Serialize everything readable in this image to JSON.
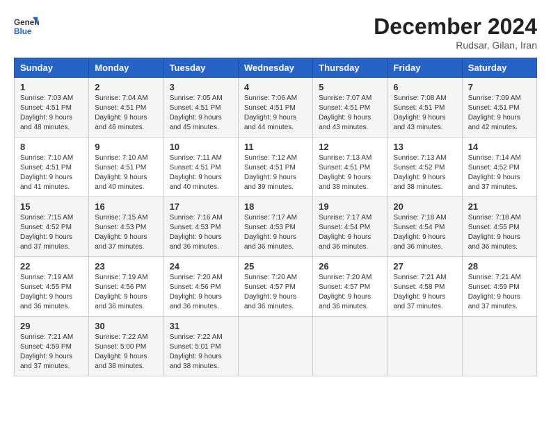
{
  "header": {
    "logo_general": "General",
    "logo_blue": "Blue",
    "title": "December 2024",
    "subtitle": "Rudsar, Gilan, Iran"
  },
  "days_of_week": [
    "Sunday",
    "Monday",
    "Tuesday",
    "Wednesday",
    "Thursday",
    "Friday",
    "Saturday"
  ],
  "weeks": [
    [
      {
        "day": "1",
        "sunrise": "7:03 AM",
        "sunset": "4:51 PM",
        "daylight": "9 hours and 48 minutes."
      },
      {
        "day": "2",
        "sunrise": "7:04 AM",
        "sunset": "4:51 PM",
        "daylight": "9 hours and 46 minutes."
      },
      {
        "day": "3",
        "sunrise": "7:05 AM",
        "sunset": "4:51 PM",
        "daylight": "9 hours and 45 minutes."
      },
      {
        "day": "4",
        "sunrise": "7:06 AM",
        "sunset": "4:51 PM",
        "daylight": "9 hours and 44 minutes."
      },
      {
        "day": "5",
        "sunrise": "7:07 AM",
        "sunset": "4:51 PM",
        "daylight": "9 hours and 43 minutes."
      },
      {
        "day": "6",
        "sunrise": "7:08 AM",
        "sunset": "4:51 PM",
        "daylight": "9 hours and 43 minutes."
      },
      {
        "day": "7",
        "sunrise": "7:09 AM",
        "sunset": "4:51 PM",
        "daylight": "9 hours and 42 minutes."
      }
    ],
    [
      {
        "day": "8",
        "sunrise": "7:10 AM",
        "sunset": "4:51 PM",
        "daylight": "9 hours and 41 minutes."
      },
      {
        "day": "9",
        "sunrise": "7:10 AM",
        "sunset": "4:51 PM",
        "daylight": "9 hours and 40 minutes."
      },
      {
        "day": "10",
        "sunrise": "7:11 AM",
        "sunset": "4:51 PM",
        "daylight": "9 hours and 40 minutes."
      },
      {
        "day": "11",
        "sunrise": "7:12 AM",
        "sunset": "4:51 PM",
        "daylight": "9 hours and 39 minutes."
      },
      {
        "day": "12",
        "sunrise": "7:13 AM",
        "sunset": "4:51 PM",
        "daylight": "9 hours and 38 minutes."
      },
      {
        "day": "13",
        "sunrise": "7:13 AM",
        "sunset": "4:52 PM",
        "daylight": "9 hours and 38 minutes."
      },
      {
        "day": "14",
        "sunrise": "7:14 AM",
        "sunset": "4:52 PM",
        "daylight": "9 hours and 37 minutes."
      }
    ],
    [
      {
        "day": "15",
        "sunrise": "7:15 AM",
        "sunset": "4:52 PM",
        "daylight": "9 hours and 37 minutes."
      },
      {
        "day": "16",
        "sunrise": "7:15 AM",
        "sunset": "4:53 PM",
        "daylight": "9 hours and 37 minutes."
      },
      {
        "day": "17",
        "sunrise": "7:16 AM",
        "sunset": "4:53 PM",
        "daylight": "9 hours and 36 minutes."
      },
      {
        "day": "18",
        "sunrise": "7:17 AM",
        "sunset": "4:53 PM",
        "daylight": "9 hours and 36 minutes."
      },
      {
        "day": "19",
        "sunrise": "7:17 AM",
        "sunset": "4:54 PM",
        "daylight": "9 hours and 36 minutes."
      },
      {
        "day": "20",
        "sunrise": "7:18 AM",
        "sunset": "4:54 PM",
        "daylight": "9 hours and 36 minutes."
      },
      {
        "day": "21",
        "sunrise": "7:18 AM",
        "sunset": "4:55 PM",
        "daylight": "9 hours and 36 minutes."
      }
    ],
    [
      {
        "day": "22",
        "sunrise": "7:19 AM",
        "sunset": "4:55 PM",
        "daylight": "9 hours and 36 minutes."
      },
      {
        "day": "23",
        "sunrise": "7:19 AM",
        "sunset": "4:56 PM",
        "daylight": "9 hours and 36 minutes."
      },
      {
        "day": "24",
        "sunrise": "7:20 AM",
        "sunset": "4:56 PM",
        "daylight": "9 hours and 36 minutes."
      },
      {
        "day": "25",
        "sunrise": "7:20 AM",
        "sunset": "4:57 PM",
        "daylight": "9 hours and 36 minutes."
      },
      {
        "day": "26",
        "sunrise": "7:20 AM",
        "sunset": "4:57 PM",
        "daylight": "9 hours and 36 minutes."
      },
      {
        "day": "27",
        "sunrise": "7:21 AM",
        "sunset": "4:58 PM",
        "daylight": "9 hours and 37 minutes."
      },
      {
        "day": "28",
        "sunrise": "7:21 AM",
        "sunset": "4:59 PM",
        "daylight": "9 hours and 37 minutes."
      }
    ],
    [
      {
        "day": "29",
        "sunrise": "7:21 AM",
        "sunset": "4:59 PM",
        "daylight": "9 hours and 37 minutes."
      },
      {
        "day": "30",
        "sunrise": "7:22 AM",
        "sunset": "5:00 PM",
        "daylight": "9 hours and 38 minutes."
      },
      {
        "day": "31",
        "sunrise": "7:22 AM",
        "sunset": "5:01 PM",
        "daylight": "9 hours and 38 minutes."
      },
      null,
      null,
      null,
      null
    ]
  ],
  "labels": {
    "sunrise": "Sunrise:",
    "sunset": "Sunset:",
    "daylight": "Daylight:"
  }
}
